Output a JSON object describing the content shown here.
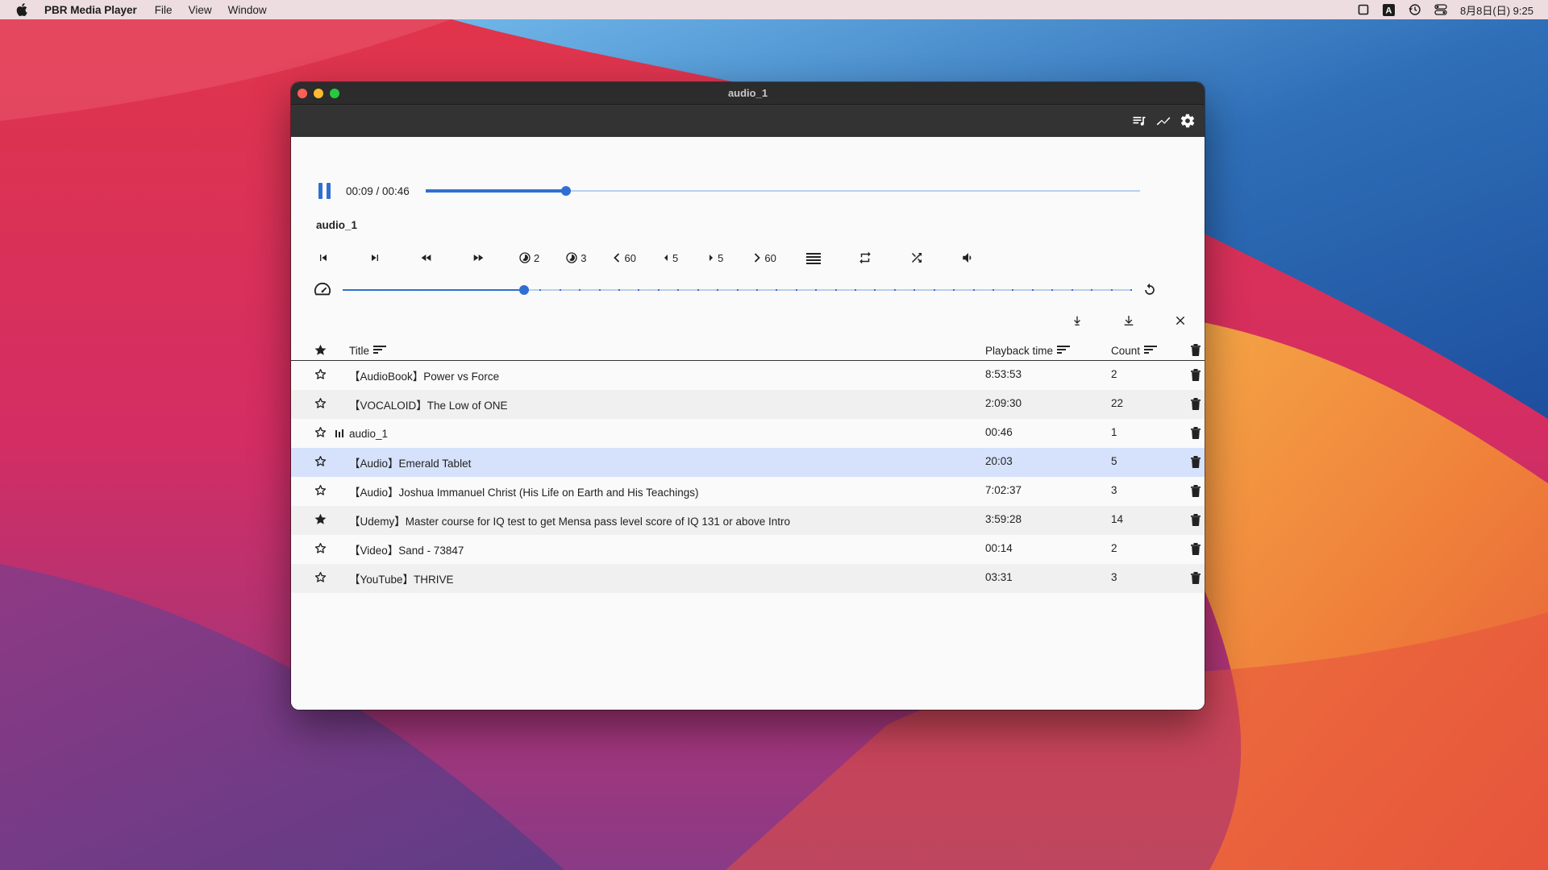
{
  "menubar": {
    "app_name": "PBR Media Player",
    "menus": [
      "File",
      "View",
      "Window"
    ],
    "clock": "8月8日(日) 9:25"
  },
  "window": {
    "title": "audio_1"
  },
  "player": {
    "time_display": "00:09 / 00:46",
    "progress": 0.196,
    "now_playing": "audio_1",
    "speed_level": 0.23
  },
  "controls": {
    "loop_a_label": "2",
    "loop_b_label": "3",
    "back60_label": "60",
    "back5_label": "5",
    "fwd5_label": "5",
    "fwd60_label": "60"
  },
  "table": {
    "headers": {
      "title": "Title",
      "playback_time": "Playback time",
      "count": "Count"
    },
    "rows": [
      {
        "title": "【AudioBook】Power vs Force",
        "time": "8:53:53",
        "count": "2",
        "starred": false,
        "playing": false,
        "selected": false
      },
      {
        "title": "【VOCALOID】The Low of ONE",
        "time": "2:09:30",
        "count": "22",
        "starred": false,
        "playing": false,
        "selected": false
      },
      {
        "title": "audio_1",
        "time": "00:46",
        "count": "1",
        "starred": false,
        "playing": true,
        "selected": false
      },
      {
        "title": "【Audio】Emerald Tablet",
        "time": "20:03",
        "count": "5",
        "starred": false,
        "playing": false,
        "selected": true
      },
      {
        "title": "【Audio】Joshua Immanuel Christ (His Life on Earth and His Teachings)",
        "time": "7:02:37",
        "count": "3",
        "starred": false,
        "playing": false,
        "selected": false
      },
      {
        "title": "【Udemy】Master course for IQ test to get Mensa pass level score of IQ 131 or above Intro",
        "time": "3:59:28",
        "count": "14",
        "starred": true,
        "playing": false,
        "selected": false
      },
      {
        "title": "【Video】Sand - 73847",
        "time": "00:14",
        "count": "2",
        "starred": false,
        "playing": false,
        "selected": false
      },
      {
        "title": "【YouTube】THRIVE",
        "time": "03:31",
        "count": "3",
        "starred": false,
        "playing": false,
        "selected": false
      }
    ]
  },
  "colors": {
    "accent": "#2f6fd1",
    "selected_row": "#d6e2fb",
    "titlebar": "#2c2c2c",
    "toolbar": "#333333"
  }
}
